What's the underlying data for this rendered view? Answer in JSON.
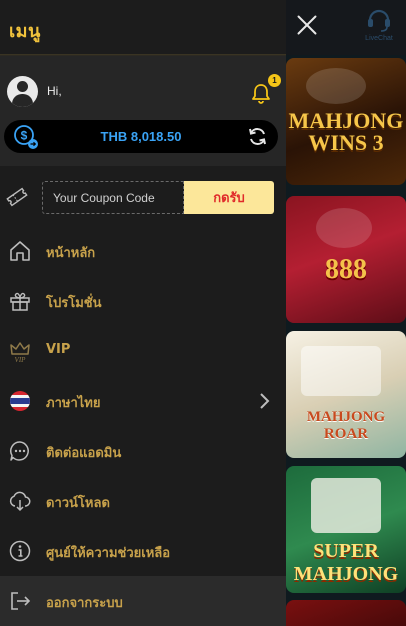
{
  "header": {
    "title": "เมนู",
    "livechat_label": "LiveChat"
  },
  "user": {
    "greeting": "Hi,",
    "notification_count": "1",
    "balance": "THB 8,018.50"
  },
  "coupon": {
    "placeholder": "Your Coupon Code",
    "button_label": "กดรับ"
  },
  "menu": [
    {
      "label": "หน้าหลัก",
      "icon": "home-icon"
    },
    {
      "label": "โปรโมชั่น",
      "icon": "gift-icon"
    },
    {
      "label": "VIP",
      "icon": "crown-icon"
    },
    {
      "label": "ภาษาไทย",
      "icon": "thai-flag-icon"
    },
    {
      "label": "ติดต่อแอดมิน",
      "icon": "chat-icon"
    },
    {
      "label": "ดาวน์โหลด",
      "icon": "download-icon"
    },
    {
      "label": "ศูนย์ให้ความช่วยเหลือ",
      "icon": "info-icon"
    },
    {
      "label": "ออกจากระบบ",
      "icon": "logout-icon"
    }
  ],
  "games": [
    {
      "title": "MAHJONG WINS 3"
    },
    {
      "title": "888"
    },
    {
      "title": "MAHJONG ROAR"
    },
    {
      "title": "SUPER MAHJONG"
    }
  ],
  "colors": {
    "accent": "#f0c23c",
    "menu_text": "#c8a24b",
    "balance": "#3aa3f5",
    "coupon_button": "#fce79a"
  }
}
